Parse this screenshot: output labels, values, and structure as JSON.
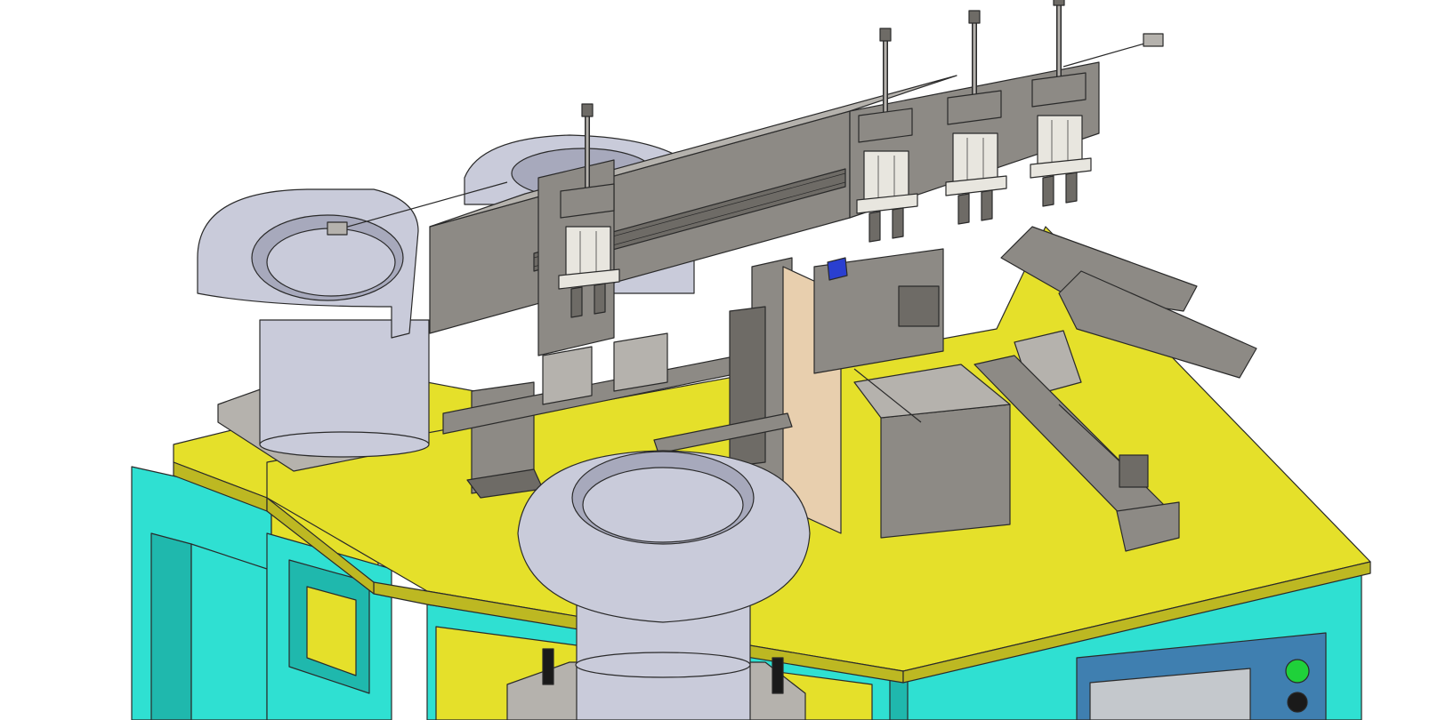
{
  "colors": {
    "frame": "#2fe0d2",
    "frame_dark": "#1fb8ad",
    "table_top": "#e5e02a",
    "table_edge": "#bdb822",
    "metal": "#8d8a85",
    "metal_dark": "#6e6b66",
    "metal_light": "#b5b2ad",
    "bowl": "#c9cbda",
    "bowl_dark": "#a7a9bc",
    "cylinder": "#e8e6df",
    "hose": "#e9e5d6",
    "panel": "#3f7fb0",
    "screen": "#c4c8cc",
    "button_start": "#1fd13a",
    "button_stop": "#1a1a1a",
    "accent_blue": "#2a3fd0",
    "wood": "#e8cfae"
  },
  "icons": [
    "vibratory-bowl-feeder-icon",
    "pneumatic-cylinder-icon",
    "stepper-motor-icon",
    "push-button-icon"
  ]
}
